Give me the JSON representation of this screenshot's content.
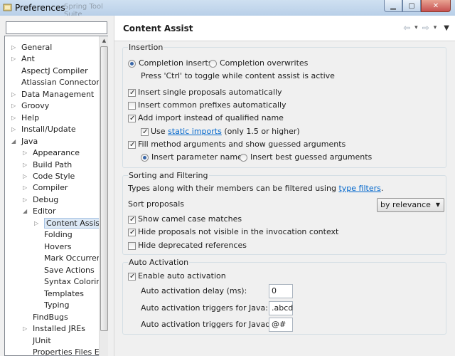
{
  "window": {
    "title": "Preferences",
    "ghost_tab": "Spring Tool Suite"
  },
  "tree": {
    "filter_placeholder": "",
    "items": [
      {
        "label": "General",
        "expander": "collapsed"
      },
      {
        "label": "Ant",
        "expander": "collapsed"
      },
      {
        "label": "AspectJ Compiler",
        "expander": "none"
      },
      {
        "label": "Atlassian Connector",
        "expander": "none"
      },
      {
        "label": "Data Management",
        "expander": "collapsed"
      },
      {
        "label": "Groovy",
        "expander": "collapsed"
      },
      {
        "label": "Help",
        "expander": "collapsed"
      },
      {
        "label": "Install/Update",
        "expander": "collapsed"
      },
      {
        "label": "Java",
        "expander": "expanded"
      },
      {
        "label": "Appearance",
        "expander": "collapsed"
      },
      {
        "label": "Build Path",
        "expander": "collapsed"
      },
      {
        "label": "Code Style",
        "expander": "collapsed"
      },
      {
        "label": "Compiler",
        "expander": "collapsed"
      },
      {
        "label": "Debug",
        "expander": "collapsed"
      },
      {
        "label": "Editor",
        "expander": "expanded"
      },
      {
        "label": "Content Assist",
        "expander": "collapsed",
        "selected": true
      },
      {
        "label": "Folding",
        "expander": "none"
      },
      {
        "label": "Hovers",
        "expander": "none"
      },
      {
        "label": "Mark Occurrenc",
        "expander": "none"
      },
      {
        "label": "Save Actions",
        "expander": "none"
      },
      {
        "label": "Syntax Coloring",
        "expander": "none"
      },
      {
        "label": "Templates",
        "expander": "none"
      },
      {
        "label": "Typing",
        "expander": "none"
      },
      {
        "label": "FindBugs",
        "expander": "none"
      },
      {
        "label": "Installed JREs",
        "expander": "collapsed"
      },
      {
        "label": "JUnit",
        "expander": "none"
      },
      {
        "label": "Properties Files Edi",
        "expander": "none"
      }
    ]
  },
  "page": {
    "title": "Content Assist",
    "nav": {
      "back": "⇦",
      "back_menu": "▾",
      "forward": "⇨",
      "forward_menu": "▾",
      "view_menu": "▼"
    }
  },
  "insertion": {
    "title": "Insertion",
    "completion_inserts": "Completion inserts",
    "completion_overwrites": "Completion overwrites",
    "toggle_hint": "Press 'Ctrl' to toggle while content assist is active",
    "insert_single": "Insert single proposals automatically",
    "insert_common": "Insert common prefixes automatically",
    "add_import": "Add import instead of qualified name",
    "use": "Use",
    "static_imports": "static imports",
    "static_suffix": "(only 1.5 or higher)",
    "fill_method": "Fill method arguments and show guessed arguments",
    "insert_param_names": "Insert parameter names",
    "insert_best_guessed": "Insert best guessed arguments"
  },
  "sorting": {
    "title": "Sorting and Filtering",
    "filter_text": "Types along with their members can be filtered using",
    "type_filters": "type filters",
    "filter_suffix": ".",
    "sort_proposals": "Sort proposals",
    "sort_value": "by relevance",
    "camel_case": "Show camel case matches",
    "hide_not_visible": "Hide proposals not visible in the invocation context",
    "hide_deprecated": "Hide deprecated references"
  },
  "auto_activation": {
    "title": "Auto Activation",
    "enable": "Enable auto activation",
    "delay_label": "Auto activation delay (ms):",
    "delay_value": "0",
    "java_label": "Auto activation triggers for Java:",
    "java_value": ".abcd",
    "javadoc_label": "Auto activation triggers for Javadoc:",
    "javadoc_value": "@#"
  },
  "colors": {
    "link": "#0066cc",
    "selection": "#dce8f5"
  }
}
